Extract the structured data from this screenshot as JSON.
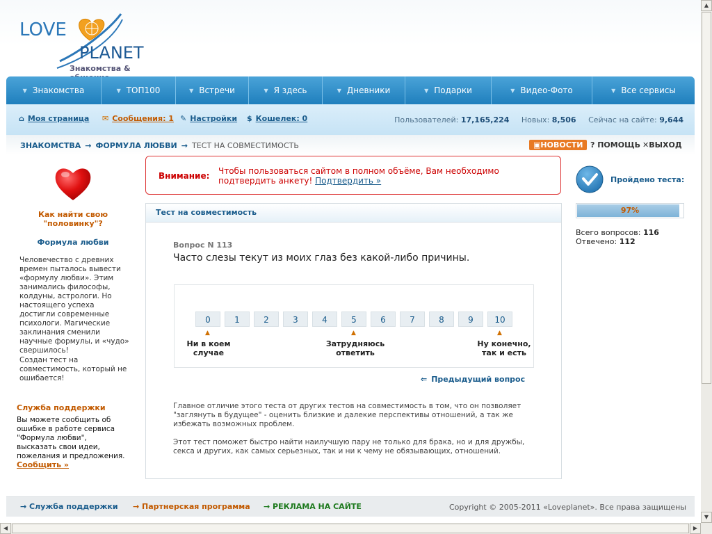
{
  "logo": {
    "word1": "LOVE",
    "word2": "PLANET",
    "tagline": "Знакомства & общение"
  },
  "nav": [
    {
      "label": "Знакомства"
    },
    {
      "label": "ТОП100"
    },
    {
      "label": "Встречи"
    },
    {
      "label": "Я здесь"
    },
    {
      "label": "Дневники"
    },
    {
      "label": "Подарки"
    },
    {
      "label": "Видео-Фото"
    },
    {
      "label": "Все сервисы"
    }
  ],
  "subnav": {
    "my_page": "Моя страница",
    "messages": "Сообщения: 1",
    "settings": "Настройки",
    "wallet": "Кошелек: 0",
    "stats": {
      "users_label": "Пользователей:",
      "users": "17,165,224",
      "new_label": "Новых:",
      "new": "8,506",
      "online_label": "Сейчас на сайте:",
      "online": "9,644"
    }
  },
  "breadcrumb": {
    "c1": "ЗНАКОМСТВА",
    "c2": "ФОРМУЛА ЛЮБВИ",
    "current": "ТЕСТ НА СОВМЕСТИМОСТЬ",
    "news": "НОВОСТИ",
    "help": "ПОМОЩЬ",
    "exit": "ВЫХОД"
  },
  "left": {
    "title1": "Как найти свою \"половинку\"?",
    "title2": "Формула любви",
    "text1": "Человечество с древних времен пыталось вывести «формулу любви». Этим занимались философы, колдуны, астрологи. Но настоящего успеха достигли современные психологи. Магические заклинания сменили научные формулы, и «чудо» свершилось!",
    "text2": "Создан тест на совместимость, который не ошибается!",
    "support_title": "Служба поддержки",
    "support_text": "Вы можете сообщить об ошибке в работе сервиса \"Формула любви\", высказать свои идеи, пожелания и предложения.",
    "support_link": "Сообщить »"
  },
  "warning": {
    "label": "Внимание:",
    "text": "Чтобы пользоваться сайтом в полном объёме, Вам необходимо подтвердить анкету!",
    "link": "Подтвердить »"
  },
  "test": {
    "panel_title": "Тест на совместимость",
    "question_number": "Вопрос N 113",
    "question": "Часто слезы текут из моих глаз без какой-либо причины.",
    "scale": [
      "0",
      "1",
      "2",
      "3",
      "4",
      "5",
      "6",
      "7",
      "8",
      "9",
      "10"
    ],
    "label_min": "Ни в коем случае",
    "label_mid": "Затрудняюсь ответить",
    "label_max": "Ну конечно, так и есть",
    "prev": "Предыдущий вопрос",
    "desc1": "Главное отличие этого теста от других тестов на совместимость в том, что он позволяет \"заглянуть в будущее\" - оценить близкие и далекие перспективы отношений, а так же избежать возможных проблем.",
    "desc2": "Этот тест поможет быстро найти наилучшую пару не только для брака, но и для дружбы, секса и других, как самых серьезных, так и ни к чему не обязывающих, отношений."
  },
  "progress": {
    "passed_label": "Пройдено теста:",
    "percent": 97,
    "percent_text": "97%",
    "total_label": "Всего вопросов:",
    "total": "116",
    "answered_label": "Отвечено:",
    "answered": "112"
  },
  "footer": {
    "support": "Служба поддержки",
    "partner": "Партнерская программа",
    "ads": "РЕКЛАМА НА САЙТЕ",
    "copyright": "Copyright © 2005-2011 «Loveplanet». Все права защищены"
  },
  "colors": {
    "accent": "#1f7fbd",
    "link": "#1a5c8c",
    "warning": "#cc0000",
    "orange": "#c25a00"
  }
}
